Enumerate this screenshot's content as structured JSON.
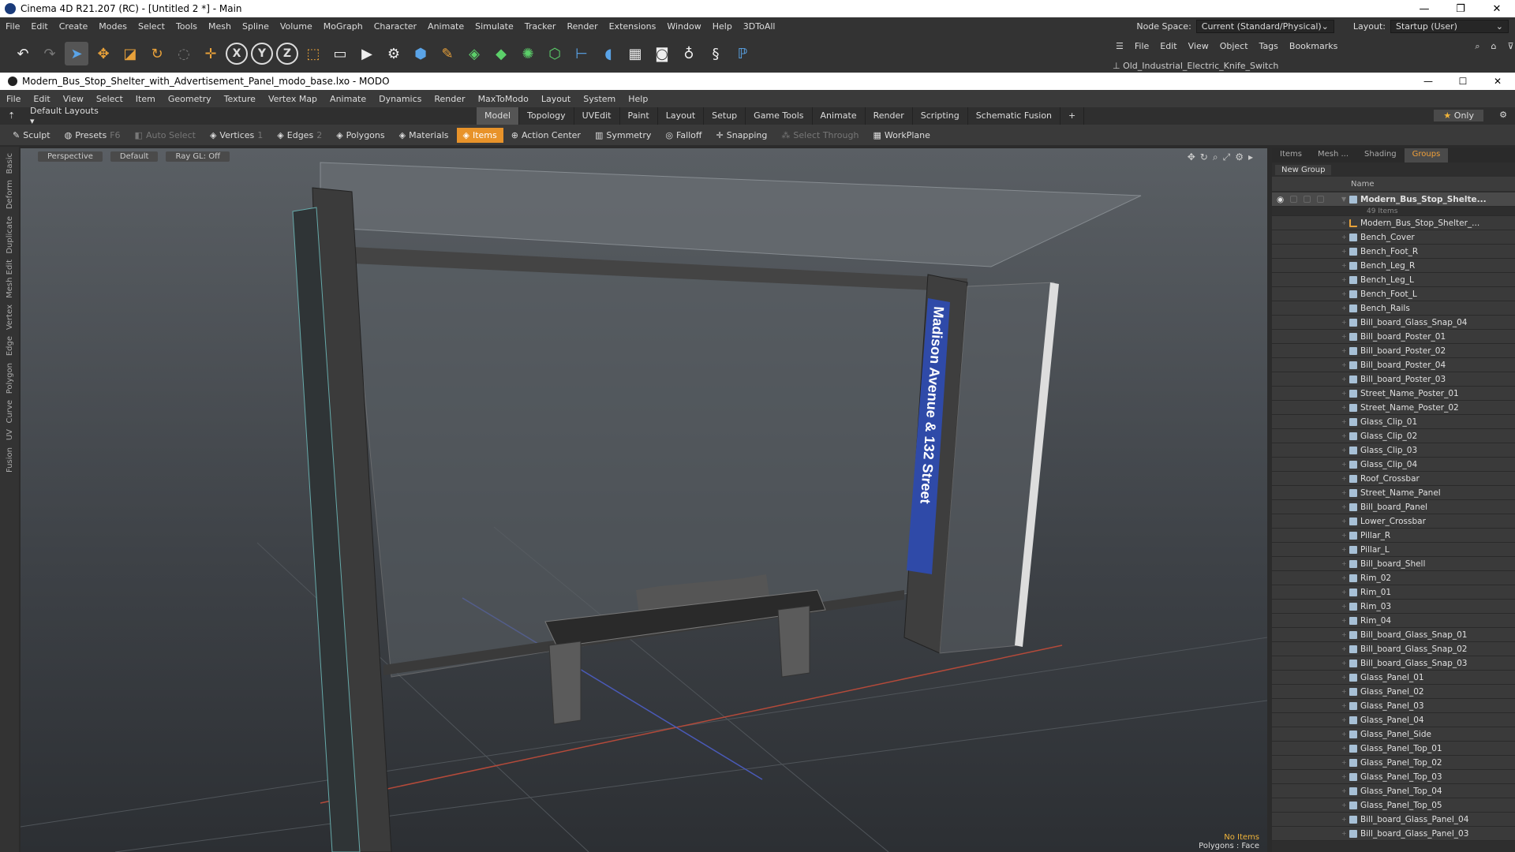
{
  "c4d": {
    "title": "Cinema 4D R21.207 (RC) - [Untitled 2 *] - Main",
    "menu": [
      "File",
      "Edit",
      "Create",
      "Modes",
      "Select",
      "Tools",
      "Mesh",
      "Spline",
      "Volume",
      "MoGraph",
      "Character",
      "Animate",
      "Simulate",
      "Tracker",
      "Render",
      "Extensions",
      "Window",
      "Help",
      "3DToAll"
    ],
    "node_space_label": "Node Space:",
    "node_space_value": "Current (Standard/Physical)",
    "layout_label": "Layout:",
    "layout_value": "Startup (User)",
    "obj_menu": [
      "File",
      "Edit",
      "View",
      "Object",
      "Tags",
      "Bookmarks"
    ],
    "object_name": "Old_Industrial_Electric_Knife_Switch"
  },
  "modo": {
    "title": "Modern_Bus_Stop_Shelter_with_Advertisement_Panel_modo_base.lxo - MODO",
    "menu": [
      "File",
      "Edit",
      "View",
      "Select",
      "Item",
      "Geometry",
      "Texture",
      "Vertex Map",
      "Animate",
      "Dynamics",
      "Render",
      "MaxToModo",
      "Layout",
      "System",
      "Help"
    ],
    "layouts_label": "Default Layouts",
    "tabs": [
      "Model",
      "Topology",
      "UVEdit",
      "Paint",
      "Layout",
      "Setup",
      "Game Tools",
      "Animate",
      "Render",
      "Scripting",
      "Schematic Fusion"
    ],
    "active_tab": "Model",
    "only_label": "Only",
    "tools": {
      "sculpt": "Sculpt",
      "presets": "Presets",
      "presets_key": "F6",
      "auto_select": "Auto Select",
      "vertices": "Vertices",
      "vertices_count": "1",
      "edges": "Edges",
      "edges_count": "2",
      "polygons": "Polygons",
      "materials": "Materials",
      "items": "Items",
      "action_center": "Action Center",
      "symmetry": "Symmetry",
      "falloff": "Falloff",
      "snapping": "Snapping",
      "select_through": "Select Through",
      "workplane": "WorkPlane"
    },
    "left_tabs": [
      "Basic",
      "Deform",
      "Duplicate",
      "Mesh Edit",
      "Vertex",
      "Edge",
      "Polygon",
      "Curve",
      "UV",
      "Fusion"
    ],
    "viewport": {
      "view": "Perspective",
      "shading": "Default",
      "raygl": "Ray GL: Off",
      "sign_text": "Madison Avenue & 132 Street",
      "status_items": "No Items",
      "status_mode": "Polygons : Face"
    },
    "panel": {
      "tabs": [
        "Items",
        "Mesh ...",
        "Shading",
        "Groups"
      ],
      "active_tab": "Groups",
      "new_group": "New Group",
      "col_name": "Name",
      "group_name": "Modern_Bus_Stop_Shelte...",
      "group_sub": "49 Items",
      "items": [
        "Modern_Bus_Stop_Shelter_...",
        "Bench_Cover",
        "Bench_Foot_R",
        "Bench_Leg_R",
        "Bench_Leg_L",
        "Bench_Foot_L",
        "Bench_Rails",
        "Bill_board_Glass_Snap_04",
        "Bill_board_Poster_01",
        "Bill_board_Poster_02",
        "Bill_board_Poster_04",
        "Bill_board_Poster_03",
        "Street_Name_Poster_01",
        "Street_Name_Poster_02",
        "Glass_Clip_01",
        "Glass_Clip_02",
        "Glass_Clip_03",
        "Glass_Clip_04",
        "Roof_Crossbar",
        "Street_Name_Panel",
        "Bill_board_Panel",
        "Lower_Crossbar",
        "Pillar_R",
        "Pillar_L",
        "Bill_board_Shell",
        "Rim_02",
        "Rim_01",
        "Rim_03",
        "Rim_04",
        "Bill_board_Glass_Snap_01",
        "Bill_board_Glass_Snap_02",
        "Bill_board_Glass_Snap_03",
        "Glass_Panel_01",
        "Glass_Panel_02",
        "Glass_Panel_03",
        "Glass_Panel_04",
        "Glass_Panel_Side",
        "Glass_Panel_Top_01",
        "Glass_Panel_Top_02",
        "Glass_Panel_Top_03",
        "Glass_Panel_Top_04",
        "Glass_Panel_Top_05",
        "Bill_board_Glass_Panel_04",
        "Bill_board_Glass_Panel_03"
      ]
    }
  }
}
